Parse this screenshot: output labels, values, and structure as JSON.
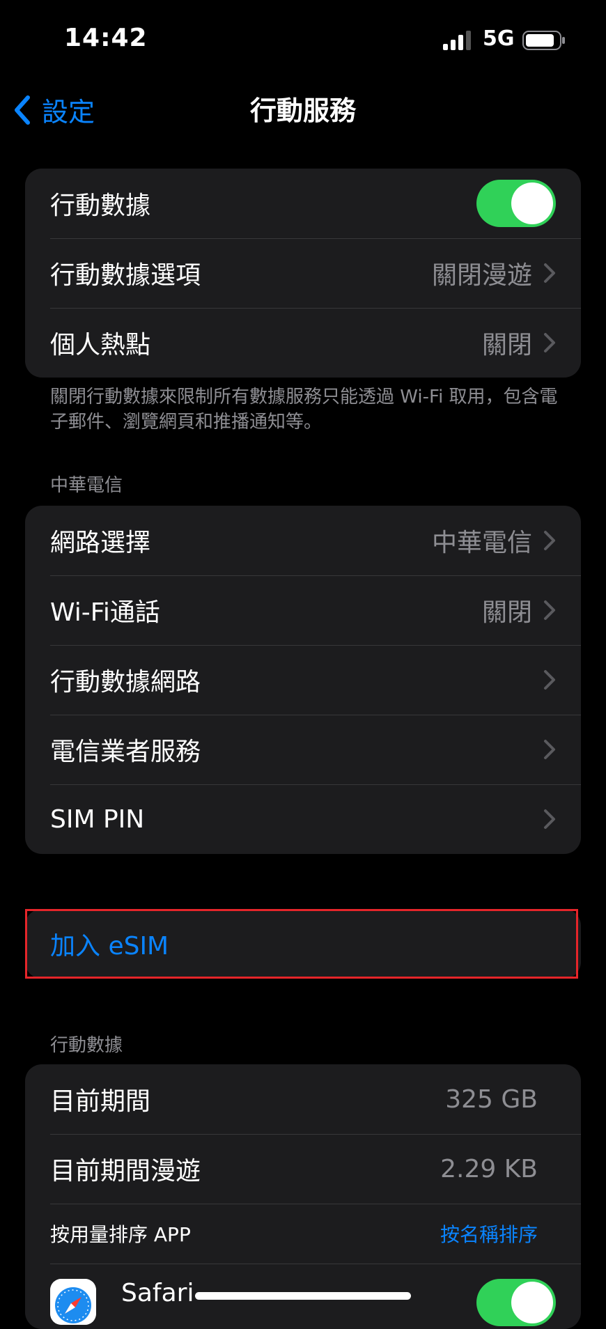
{
  "status_bar": {
    "time": "14:42",
    "network": "5G"
  },
  "nav": {
    "back_label": "設定",
    "title": "行動服務"
  },
  "group1": {
    "mobile_data_label": "行動數據",
    "mobile_data_on": true,
    "data_options_label": "行動數據選項",
    "data_options_value": "關閉漫遊",
    "hotspot_label": "個人熱點",
    "hotspot_value": "關閉"
  },
  "footer_note": "關閉行動數據來限制所有數據服務只能透過 Wi-Fi 取用，包含電子郵件、瀏覽網頁和推播通知等。",
  "carrier": {
    "header": "中華電信",
    "network_select_label": "網路選擇",
    "network_select_value": "中華電信",
    "wifi_calling_label": "Wi-Fi通話",
    "wifi_calling_value": "關閉",
    "cellular_network_label": "行動數據網路",
    "carrier_services_label": "電信業者服務",
    "sim_pin_label": "SIM PIN"
  },
  "esim": {
    "add_label": "加入 eSIM"
  },
  "usage": {
    "header": "行動數據",
    "current_period_label": "目前期間",
    "current_period_value": "325 GB",
    "current_roaming_label": "目前期間漫遊",
    "current_roaming_value": "2.29 KB",
    "sort_label": "按用量排序 APP",
    "sort_link": "按名稱排序",
    "apps": [
      {
        "name": "Safari",
        "enabled": true
      }
    ]
  },
  "colors": {
    "accent": "#0a84ff",
    "toggle_on": "#30d158",
    "highlight": "#e5252a"
  }
}
